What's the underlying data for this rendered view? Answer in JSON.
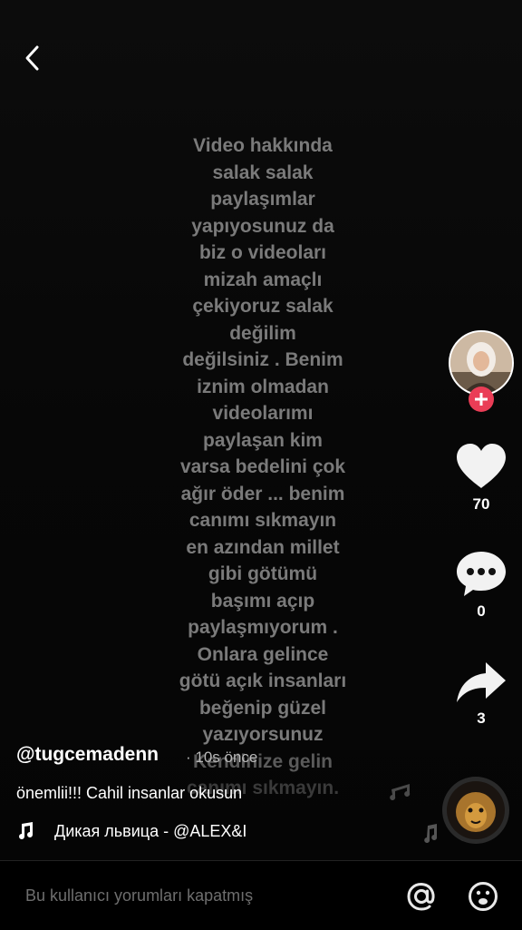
{
  "video": {
    "overlay_lines": [
      "Video hakkında",
      "salak salak",
      "paylaşımlar",
      "yapıyosunuz da",
      "biz o videoları",
      "mizah amaçlı",
      "çekiyoruz salak",
      "değilim",
      "değilsiniz . Benim",
      "iznim olmadan",
      "videolarımı",
      "paylaşan kim",
      "varsa bedelini çok",
      "ağır öder ... benim",
      "canımı sıkmayın",
      "en azından millet",
      "gibi götümü",
      "başımı açıp",
      "paylaşmıyorum .",
      "Onlara gelince",
      "götü açık insanları",
      "beğenip güzel",
      "yazıyorsunuz",
      "Kendinize gelin",
      "canımı sıkmayın."
    ]
  },
  "post": {
    "username": "@tugcemadenn",
    "timestamp": "· 10s önce",
    "caption": "önemlii!!! Cahil insanlar okusun",
    "music_title": "Дикая львица - @ALEX&I"
  },
  "actions": {
    "likes": "70",
    "comments": "0",
    "shares": "3"
  },
  "bottom": {
    "comment_status": "Bu kullanıcı yorumları kapatmış"
  },
  "colors": {
    "background": "#000000",
    "follow_accent": "#ea3d56",
    "overlay_text": "#7a7a7a"
  },
  "icons": [
    "back-icon",
    "plus-icon",
    "heart-icon",
    "comment-icon",
    "share-icon",
    "music-note-icon",
    "at-icon",
    "emoji-icon"
  ]
}
